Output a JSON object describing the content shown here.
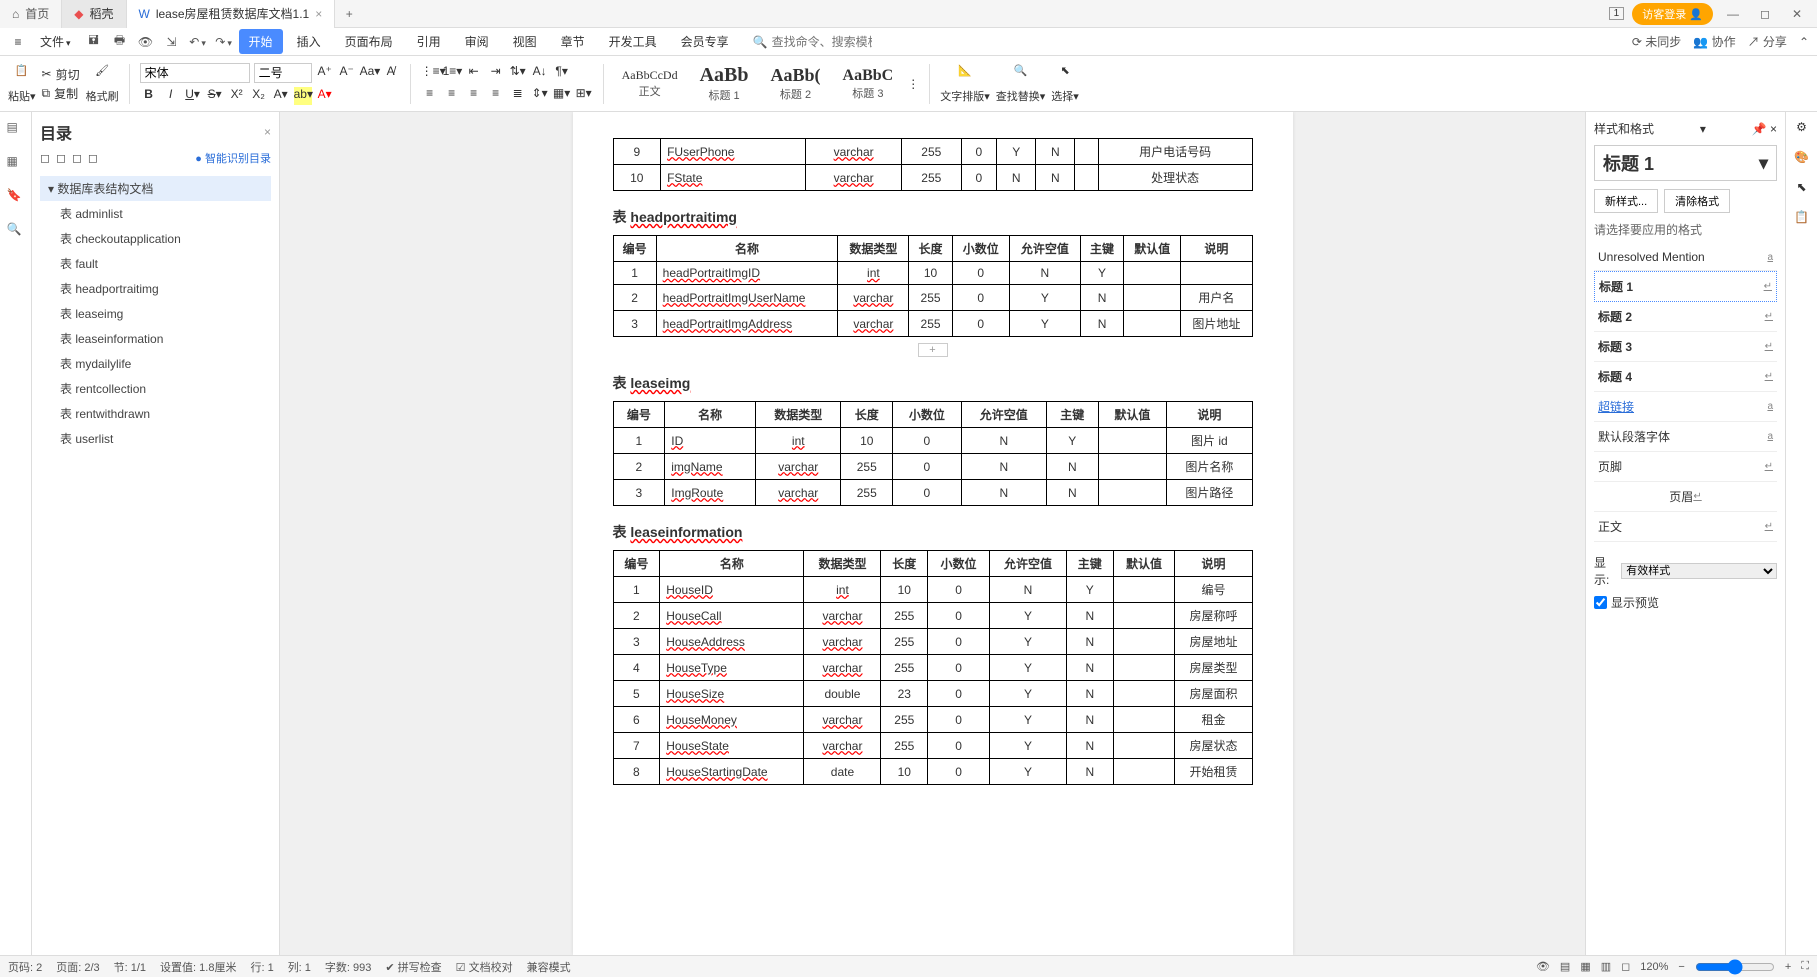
{
  "titlebar": {
    "tabs": [
      {
        "label": "首页",
        "icon": "home"
      },
      {
        "label": "稻壳",
        "icon": "docer"
      },
      {
        "label": "lease房屋租赁数据库文档1.1",
        "icon": "word",
        "active": true
      }
    ],
    "login": "访客登录"
  },
  "ribbonTabs": {
    "file": "文件",
    "tabs": [
      "开始",
      "插入",
      "页面布局",
      "引用",
      "审阅",
      "视图",
      "章节",
      "开发工具",
      "会员专享"
    ],
    "searchPlaceholder": "查找命令、搜索模板",
    "right": [
      "未同步",
      "协作",
      "分享"
    ]
  },
  "ribbon": {
    "paste": "粘贴",
    "cut": "剪切",
    "copy": "复制",
    "formatPainter": "格式刷",
    "fontName": "宋体",
    "fontSize": "二号",
    "styles": [
      {
        "preview": "AaBbCcDd",
        "label": "正文"
      },
      {
        "preview": "AaBb",
        "label": "标题 1"
      },
      {
        "preview": "AaBb(",
        "label": "标题 2"
      },
      {
        "preview": "AaBbC",
        "label": "标题 3"
      }
    ],
    "textLayout": "文字排版",
    "findReplace": "查找替换",
    "select": "选择"
  },
  "toc": {
    "title": "目录",
    "smart": "智能识别目录",
    "root": "数据库表结构文档",
    "items": [
      "表 adminlist",
      "表 checkoutapplication",
      "表 fault",
      "表 headportraitimg",
      "表 leaseimg",
      "表 leaseinformation",
      "表 mydailylife",
      "表 rentcollection",
      "表 rentwithdrawn",
      "表 userlist"
    ]
  },
  "doc": {
    "topRows": [
      {
        "no": "9",
        "name": "FUserPhone",
        "type": "varchar",
        "len": "255",
        "dec": "0",
        "null": "Y",
        "pk": "N",
        "def": "",
        "desc": "用户电话号码"
      },
      {
        "no": "10",
        "name": "FState",
        "type": "varchar",
        "len": "255",
        "dec": "0",
        "null": "N",
        "pk": "N",
        "def": "",
        "desc": "处理状态"
      }
    ],
    "section1": {
      "prefix": "表 ",
      "name": "headportraitimg"
    },
    "headers": [
      "编号",
      "名称",
      "数据类型",
      "长度",
      "小数位",
      "允许空值",
      "主键",
      "默认值",
      "说明"
    ],
    "table1": [
      {
        "no": "1",
        "name": "headPortraitImgID",
        "type": "int",
        "len": "10",
        "dec": "0",
        "null": "N",
        "pk": "Y",
        "def": "",
        "desc": ""
      },
      {
        "no": "2",
        "name": "headPortraitImgUserName",
        "type": "varchar",
        "len": "255",
        "dec": "0",
        "null": "Y",
        "pk": "N",
        "def": "",
        "desc": "用户名"
      },
      {
        "no": "3",
        "name": "headPortraitImgAddress",
        "type": "varchar",
        "len": "255",
        "dec": "0",
        "null": "Y",
        "pk": "N",
        "def": "",
        "desc": "图片地址"
      }
    ],
    "section2": {
      "prefix": "表 ",
      "name": "leaseimg"
    },
    "table2": [
      {
        "no": "1",
        "name": "ID",
        "type": "int",
        "len": "10",
        "dec": "0",
        "null": "N",
        "pk": "Y",
        "def": "",
        "desc": "图片 id"
      },
      {
        "no": "2",
        "name": "imgName",
        "type": "varchar",
        "len": "255",
        "dec": "0",
        "null": "N",
        "pk": "N",
        "def": "",
        "desc": "图片名称"
      },
      {
        "no": "3",
        "name": "ImgRoute",
        "type": "varchar",
        "len": "255",
        "dec": "0",
        "null": "N",
        "pk": "N",
        "def": "",
        "desc": "图片路径"
      }
    ],
    "section3": {
      "prefix": "表 ",
      "name": "leaseinformation"
    },
    "table3": [
      {
        "no": "1",
        "name": "HouseID",
        "type": "int",
        "len": "10",
        "dec": "0",
        "null": "N",
        "pk": "Y",
        "def": "",
        "desc": "编号"
      },
      {
        "no": "2",
        "name": "HouseCall",
        "type": "varchar",
        "len": "255",
        "dec": "0",
        "null": "Y",
        "pk": "N",
        "def": "",
        "desc": "房屋称呼"
      },
      {
        "no": "3",
        "name": "HouseAddress",
        "type": "varchar",
        "len": "255",
        "dec": "0",
        "null": "Y",
        "pk": "N",
        "def": "",
        "desc": "房屋地址"
      },
      {
        "no": "4",
        "name": "HouseType",
        "type": "varchar",
        "len": "255",
        "dec": "0",
        "null": "Y",
        "pk": "N",
        "def": "",
        "desc": "房屋类型"
      },
      {
        "no": "5",
        "name": "HouseSize",
        "type": "double",
        "len": "23",
        "dec": "0",
        "null": "Y",
        "pk": "N",
        "def": "",
        "desc": "房屋面积"
      },
      {
        "no": "6",
        "name": "HouseMoney",
        "type": "varchar",
        "len": "255",
        "dec": "0",
        "null": "Y",
        "pk": "N",
        "def": "",
        "desc": "租金"
      },
      {
        "no": "7",
        "name": "HouseState",
        "type": "varchar",
        "len": "255",
        "dec": "0",
        "null": "Y",
        "pk": "N",
        "def": "",
        "desc": "房屋状态"
      },
      {
        "no": "8",
        "name": "HouseStartingDate",
        "type": "date",
        "len": "10",
        "dec": "0",
        "null": "Y",
        "pk": "N",
        "def": "",
        "desc": "开始租赁"
      }
    ]
  },
  "stylePanel": {
    "title": "样式和格式",
    "current": "标题 1",
    "newStyle": "新样式...",
    "clearFormat": "清除格式",
    "hint": "请选择要应用的格式",
    "list": [
      {
        "label": "Unresolved Mention",
        "mark": "a"
      },
      {
        "label": "标题 1",
        "mark": "↵",
        "selected": true,
        "bold": true
      },
      {
        "label": "标题 2",
        "mark": "↵",
        "bold": true
      },
      {
        "label": "标题 3",
        "mark": "↵",
        "bold": true
      },
      {
        "label": "标题 4",
        "mark": "↵",
        "bold": true
      },
      {
        "label": "超链接",
        "mark": "a",
        "link": true
      },
      {
        "label": "默认段落字体",
        "mark": "a"
      },
      {
        "label": "页脚",
        "mark": "↵"
      },
      {
        "label": "页眉",
        "mark": "↵",
        "center": true
      },
      {
        "label": "正文",
        "mark": "↵"
      }
    ],
    "showLabel": "显示:",
    "showValue": "有效样式",
    "preview": "显示预览"
  },
  "statusbar": {
    "pages": "页码: 2",
    "pageOf": "页面: 2/3",
    "section": "节: 1/1",
    "pos": "设置值: 1.8厘米",
    "line": "行: 1",
    "col": "列: 1",
    "words": "字数: 993",
    "spell": "拼写检查",
    "docCheck": "文档校对",
    "compat": "兼容模式",
    "zoom": "120%"
  }
}
